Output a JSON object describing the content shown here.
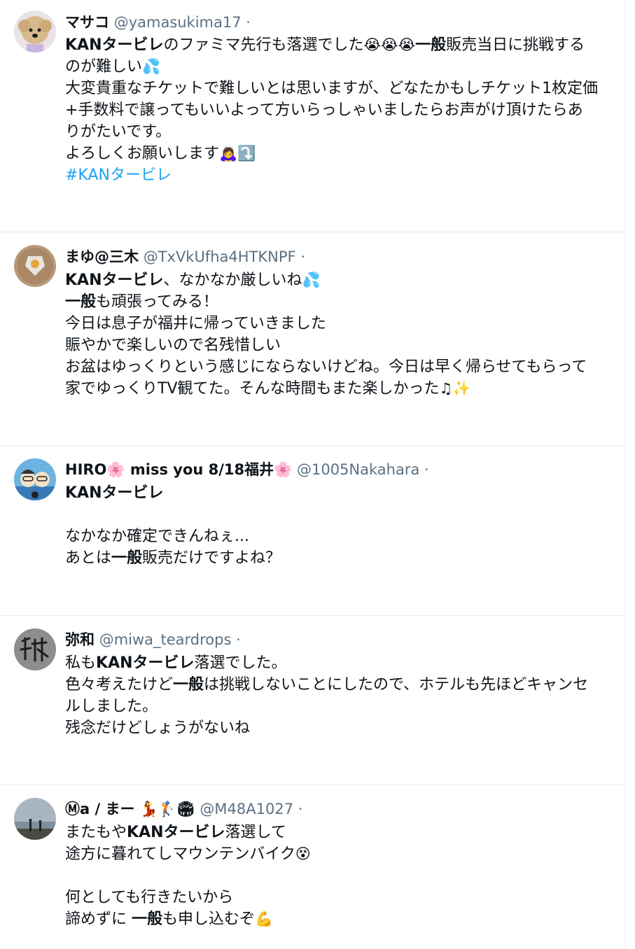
{
  "tweets": [
    {
      "name": "マサコ",
      "handle": "@yamasukima17",
      "dot": "·",
      "lines": [
        [
          {
            "t": "KANタービレ",
            "b": true
          },
          {
            "t": "のファミマ先行も落選でした"
          },
          {
            "t": "😭😭😭",
            "e": true
          },
          {
            "t": "一般",
            "b": true
          },
          {
            "t": "販売当日に挑戦する"
          }
        ],
        [
          {
            "t": "のが難しい"
          },
          {
            "t": "💦",
            "e": true
          }
        ],
        [
          {
            "t": "大変貴重なチケットで難しいとは思いますが、どなたかもしチケット1枚定価"
          }
        ],
        [
          {
            "t": "+手数料で譲ってもいいよって方いらっしゃいましたらお声がけ頂けたらあ"
          }
        ],
        [
          {
            "t": "りがたいです。"
          }
        ],
        [
          {
            "t": "よろしくお願いします"
          },
          {
            "t": "🙇‍♀️⤵️",
            "e": true
          }
        ],
        [
          {
            "t": "#KANタービレ",
            "h": true
          }
        ]
      ]
    },
    {
      "name": "まゆ@三木",
      "handle": "@TxVkUfha4HTKNPF",
      "dot": "·",
      "lines": [
        [
          {
            "t": "KANタービレ",
            "b": true
          },
          {
            "t": "、なかなか厳しいね"
          },
          {
            "t": "💦",
            "e": true
          }
        ],
        [
          {
            "t": "一般",
            "b": true
          },
          {
            "t": "も頑張ってみる！"
          }
        ],
        [
          {
            "t": "今日は息子が福井に帰っていきました"
          }
        ],
        [
          {
            "t": "賑やかで楽しいので名残惜しい"
          }
        ],
        [
          {
            "t": "お盆はゆっくりという感じにならないけどね。今日は早く帰らせてもらって"
          }
        ],
        [
          {
            "t": "家でゆっくりTV観てた。そんな時間もまた楽しかった"
          },
          {
            "t": "♫✨",
            "e": true
          }
        ]
      ]
    },
    {
      "name": "HIRO🌸 miss you 8/18福井🌸",
      "handle": "@1005Nakahara",
      "dot": "·",
      "lines": [
        [
          {
            "t": "KANタービレ",
            "b": true
          }
        ],
        [],
        [
          {
            "t": "なかなか確定できんねぇ..."
          }
        ],
        [
          {
            "t": "あとは"
          },
          {
            "t": "一般",
            "b": true
          },
          {
            "t": "販売だけですよね？"
          }
        ]
      ]
    },
    {
      "name": "弥和",
      "handle": "@miwa_teardrops",
      "dot": "·",
      "lines": [
        [
          {
            "t": "私も"
          },
          {
            "t": "KANタービレ",
            "b": true
          },
          {
            "t": "落選でした。"
          }
        ],
        [
          {
            "t": "色々考えたけど"
          },
          {
            "t": "一般",
            "b": true
          },
          {
            "t": "は挑戦しないことにしたので、ホテルも先ほどキャンセ"
          }
        ],
        [
          {
            "t": "ルしました。"
          }
        ],
        [
          {
            "t": "残念だけどしょうがないね"
          }
        ]
      ]
    },
    {
      "name": "Ⓜa / まー 💃🏌🏟",
      "handle": "@M48A1027",
      "dot": "·",
      "lines": [
        [
          {
            "t": "またもや"
          },
          {
            "t": "KANタービレ",
            "b": true
          },
          {
            "t": "落選して"
          }
        ],
        [
          {
            "t": "途方に暮れてしマウンテンバイク"
          },
          {
            "t": "😵",
            "e": true
          }
        ],
        [],
        [
          {
            "t": "何としても行きたいから"
          }
        ],
        [
          {
            "t": "諦めずに "
          },
          {
            "t": "一般",
            "b": true
          },
          {
            "t": "も申し込むぞ"
          },
          {
            "t": "💪",
            "e": true
          }
        ]
      ]
    }
  ]
}
